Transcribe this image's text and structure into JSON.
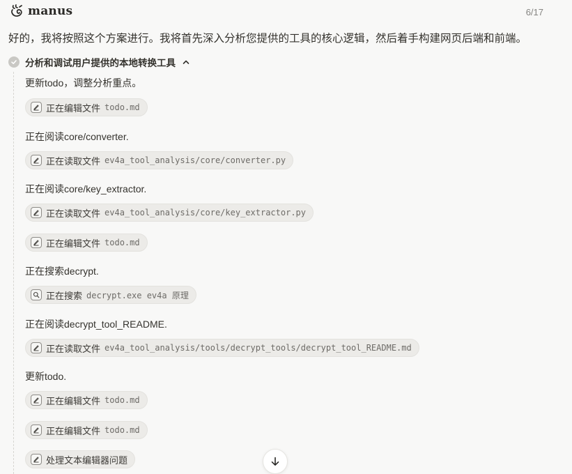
{
  "header": {
    "brand": "manus",
    "step_counter": "6/17"
  },
  "intro_message": "好的，我将按照这个方案进行。我将首先深入分析您提供的工具的核心逻辑，然后着手构建网页后端和前端。",
  "task": {
    "title": "分析和调试用户提供的本地转换工具",
    "status_icon": "check-circle-icon",
    "toggle_icon": "chevron-up-icon"
  },
  "steps": {
    "s1_text": "更新todo，调整分析重点。",
    "c1": {
      "icon": "edit-file-icon",
      "label": "正在编辑文件",
      "arg": "todo.md"
    },
    "s2_text": "正在阅读core/converter.",
    "c2": {
      "icon": "edit-file-icon",
      "label": "正在读取文件",
      "arg": "ev4a_tool_analysis/core/converter.py"
    },
    "s3_text": "正在阅读core/key_extractor.",
    "c3": {
      "icon": "edit-file-icon",
      "label": "正在读取文件",
      "arg": "ev4a_tool_analysis/core/key_extractor.py"
    },
    "c4": {
      "icon": "edit-file-icon",
      "label": "正在编辑文件",
      "arg": "todo.md"
    },
    "s4_text": "正在搜索decrypt.",
    "c5": {
      "icon": "search-icon",
      "label": "正在搜索",
      "arg": "decrypt.exe ev4a 原理"
    },
    "s5_text": "正在阅读decrypt_tool_README.",
    "c6": {
      "icon": "edit-file-icon",
      "label": "正在读取文件",
      "arg": "ev4a_tool_analysis/tools/decrypt_tools/decrypt_tool_README.md"
    },
    "s6_text": "更新todo.",
    "c7": {
      "icon": "edit-file-icon",
      "label": "正在编辑文件",
      "arg": "todo.md"
    },
    "c8": {
      "icon": "edit-file-icon",
      "label": "正在编辑文件",
      "arg": "todo.md"
    },
    "c9": {
      "icon": "edit-file-icon",
      "label": "处理文本编辑器问题"
    }
  },
  "scroll_button_icon": "arrow-down-icon"
}
